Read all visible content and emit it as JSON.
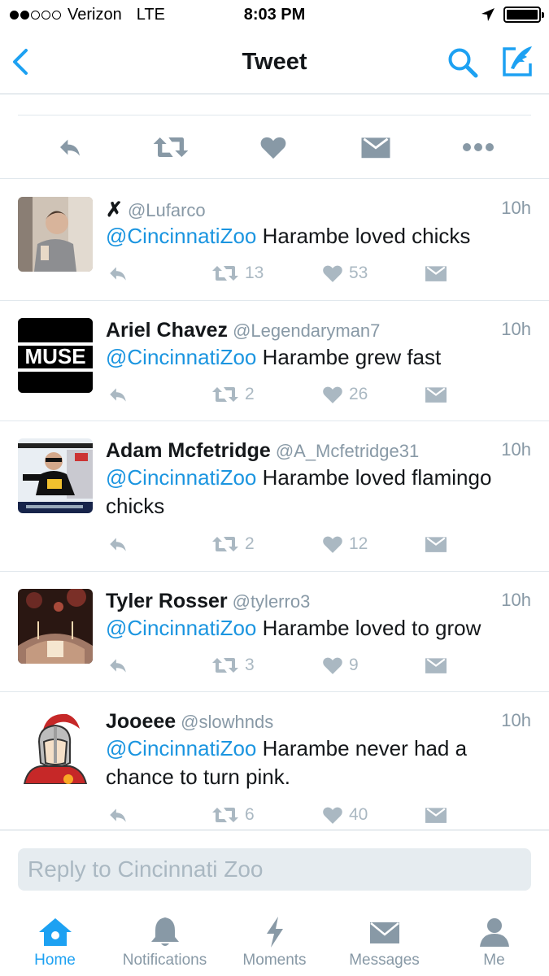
{
  "status_bar": {
    "carrier": "Verizon",
    "network": "LTE",
    "time": "8:03 PM",
    "signal_bars": 2
  },
  "nav": {
    "title": "Tweet"
  },
  "replies": [
    {
      "name": "✗",
      "handle": "@Lufarco",
      "time": "10h",
      "mention": "@CincinnatiZoo",
      "text": " Harambe loved chicks",
      "retweets": "13",
      "likes": "53"
    },
    {
      "name": "Ariel Chavez",
      "handle": "@Legendaryman7",
      "time": "10h",
      "mention": "@CincinnatiZoo",
      "text": " Harambe grew fast",
      "retweets": "2",
      "likes": "26",
      "avatar_text": "MUSE"
    },
    {
      "name": "Adam Mcfetridge",
      "handle": "@A_Mcfetridge31",
      "time": "10h",
      "mention": "@CincinnatiZoo",
      "text": " Harambe loved flamingo chicks",
      "retweets": "2",
      "likes": "12"
    },
    {
      "name": "Tyler Rosser",
      "handle": "@tylerro3",
      "time": "10h",
      "mention": "@CincinnatiZoo",
      "text": " Harambe loved to grow",
      "retweets": "3",
      "likes": "9"
    },
    {
      "name": "Jooeee",
      "handle": "@slowhnds",
      "time": "10h",
      "mention": "@CincinnatiZoo",
      "text": " Harambe never had a chance to turn pink.",
      "retweets": "6",
      "likes": "40"
    }
  ],
  "reply_box": {
    "placeholder": "Reply to Cincinnati Zoo"
  },
  "tabs": [
    {
      "label": "Home",
      "icon": "home-icon",
      "active": true
    },
    {
      "label": "Notifications",
      "icon": "bell-icon",
      "active": false
    },
    {
      "label": "Moments",
      "icon": "lightning-icon",
      "active": false
    },
    {
      "label": "Messages",
      "icon": "envelope-icon",
      "active": false
    },
    {
      "label": "Me",
      "icon": "person-icon",
      "active": false
    }
  ],
  "colors": {
    "accent": "#1da1f2",
    "mention": "#1b95e0",
    "muted": "#8899a6",
    "icon_gray": "#aab8c2"
  }
}
